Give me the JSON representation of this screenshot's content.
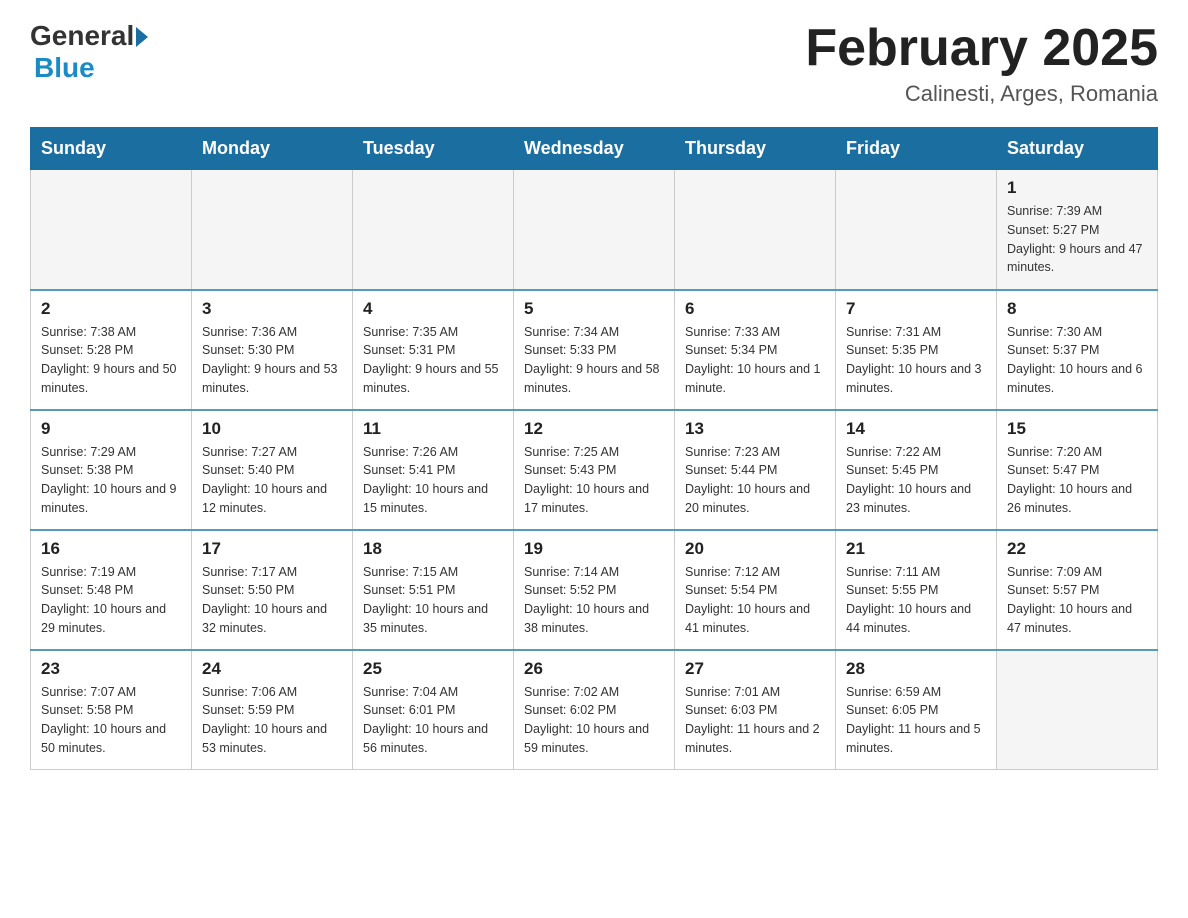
{
  "header": {
    "logo_general": "General",
    "logo_blue": "Blue",
    "title": "February 2025",
    "subtitle": "Calinesti, Arges, Romania"
  },
  "days_of_week": [
    "Sunday",
    "Monday",
    "Tuesday",
    "Wednesday",
    "Thursday",
    "Friday",
    "Saturday"
  ],
  "weeks": [
    [
      null,
      null,
      null,
      null,
      null,
      null,
      {
        "day": "1",
        "sunrise": "Sunrise: 7:39 AM",
        "sunset": "Sunset: 5:27 PM",
        "daylight": "Daylight: 9 hours and 47 minutes."
      }
    ],
    [
      {
        "day": "2",
        "sunrise": "Sunrise: 7:38 AM",
        "sunset": "Sunset: 5:28 PM",
        "daylight": "Daylight: 9 hours and 50 minutes."
      },
      {
        "day": "3",
        "sunrise": "Sunrise: 7:36 AM",
        "sunset": "Sunset: 5:30 PM",
        "daylight": "Daylight: 9 hours and 53 minutes."
      },
      {
        "day": "4",
        "sunrise": "Sunrise: 7:35 AM",
        "sunset": "Sunset: 5:31 PM",
        "daylight": "Daylight: 9 hours and 55 minutes."
      },
      {
        "day": "5",
        "sunrise": "Sunrise: 7:34 AM",
        "sunset": "Sunset: 5:33 PM",
        "daylight": "Daylight: 9 hours and 58 minutes."
      },
      {
        "day": "6",
        "sunrise": "Sunrise: 7:33 AM",
        "sunset": "Sunset: 5:34 PM",
        "daylight": "Daylight: 10 hours and 1 minute."
      },
      {
        "day": "7",
        "sunrise": "Sunrise: 7:31 AM",
        "sunset": "Sunset: 5:35 PM",
        "daylight": "Daylight: 10 hours and 3 minutes."
      },
      {
        "day": "8",
        "sunrise": "Sunrise: 7:30 AM",
        "sunset": "Sunset: 5:37 PM",
        "daylight": "Daylight: 10 hours and 6 minutes."
      }
    ],
    [
      {
        "day": "9",
        "sunrise": "Sunrise: 7:29 AM",
        "sunset": "Sunset: 5:38 PM",
        "daylight": "Daylight: 10 hours and 9 minutes."
      },
      {
        "day": "10",
        "sunrise": "Sunrise: 7:27 AM",
        "sunset": "Sunset: 5:40 PM",
        "daylight": "Daylight: 10 hours and 12 minutes."
      },
      {
        "day": "11",
        "sunrise": "Sunrise: 7:26 AM",
        "sunset": "Sunset: 5:41 PM",
        "daylight": "Daylight: 10 hours and 15 minutes."
      },
      {
        "day": "12",
        "sunrise": "Sunrise: 7:25 AM",
        "sunset": "Sunset: 5:43 PM",
        "daylight": "Daylight: 10 hours and 17 minutes."
      },
      {
        "day": "13",
        "sunrise": "Sunrise: 7:23 AM",
        "sunset": "Sunset: 5:44 PM",
        "daylight": "Daylight: 10 hours and 20 minutes."
      },
      {
        "day": "14",
        "sunrise": "Sunrise: 7:22 AM",
        "sunset": "Sunset: 5:45 PM",
        "daylight": "Daylight: 10 hours and 23 minutes."
      },
      {
        "day": "15",
        "sunrise": "Sunrise: 7:20 AM",
        "sunset": "Sunset: 5:47 PM",
        "daylight": "Daylight: 10 hours and 26 minutes."
      }
    ],
    [
      {
        "day": "16",
        "sunrise": "Sunrise: 7:19 AM",
        "sunset": "Sunset: 5:48 PM",
        "daylight": "Daylight: 10 hours and 29 minutes."
      },
      {
        "day": "17",
        "sunrise": "Sunrise: 7:17 AM",
        "sunset": "Sunset: 5:50 PM",
        "daylight": "Daylight: 10 hours and 32 minutes."
      },
      {
        "day": "18",
        "sunrise": "Sunrise: 7:15 AM",
        "sunset": "Sunset: 5:51 PM",
        "daylight": "Daylight: 10 hours and 35 minutes."
      },
      {
        "day": "19",
        "sunrise": "Sunrise: 7:14 AM",
        "sunset": "Sunset: 5:52 PM",
        "daylight": "Daylight: 10 hours and 38 minutes."
      },
      {
        "day": "20",
        "sunrise": "Sunrise: 7:12 AM",
        "sunset": "Sunset: 5:54 PM",
        "daylight": "Daylight: 10 hours and 41 minutes."
      },
      {
        "day": "21",
        "sunrise": "Sunrise: 7:11 AM",
        "sunset": "Sunset: 5:55 PM",
        "daylight": "Daylight: 10 hours and 44 minutes."
      },
      {
        "day": "22",
        "sunrise": "Sunrise: 7:09 AM",
        "sunset": "Sunset: 5:57 PM",
        "daylight": "Daylight: 10 hours and 47 minutes."
      }
    ],
    [
      {
        "day": "23",
        "sunrise": "Sunrise: 7:07 AM",
        "sunset": "Sunset: 5:58 PM",
        "daylight": "Daylight: 10 hours and 50 minutes."
      },
      {
        "day": "24",
        "sunrise": "Sunrise: 7:06 AM",
        "sunset": "Sunset: 5:59 PM",
        "daylight": "Daylight: 10 hours and 53 minutes."
      },
      {
        "day": "25",
        "sunrise": "Sunrise: 7:04 AM",
        "sunset": "Sunset: 6:01 PM",
        "daylight": "Daylight: 10 hours and 56 minutes."
      },
      {
        "day": "26",
        "sunrise": "Sunrise: 7:02 AM",
        "sunset": "Sunset: 6:02 PM",
        "daylight": "Daylight: 10 hours and 59 minutes."
      },
      {
        "day": "27",
        "sunrise": "Sunrise: 7:01 AM",
        "sunset": "Sunset: 6:03 PM",
        "daylight": "Daylight: 11 hours and 2 minutes."
      },
      {
        "day": "28",
        "sunrise": "Sunrise: 6:59 AM",
        "sunset": "Sunset: 6:05 PM",
        "daylight": "Daylight: 11 hours and 5 minutes."
      },
      null
    ]
  ]
}
